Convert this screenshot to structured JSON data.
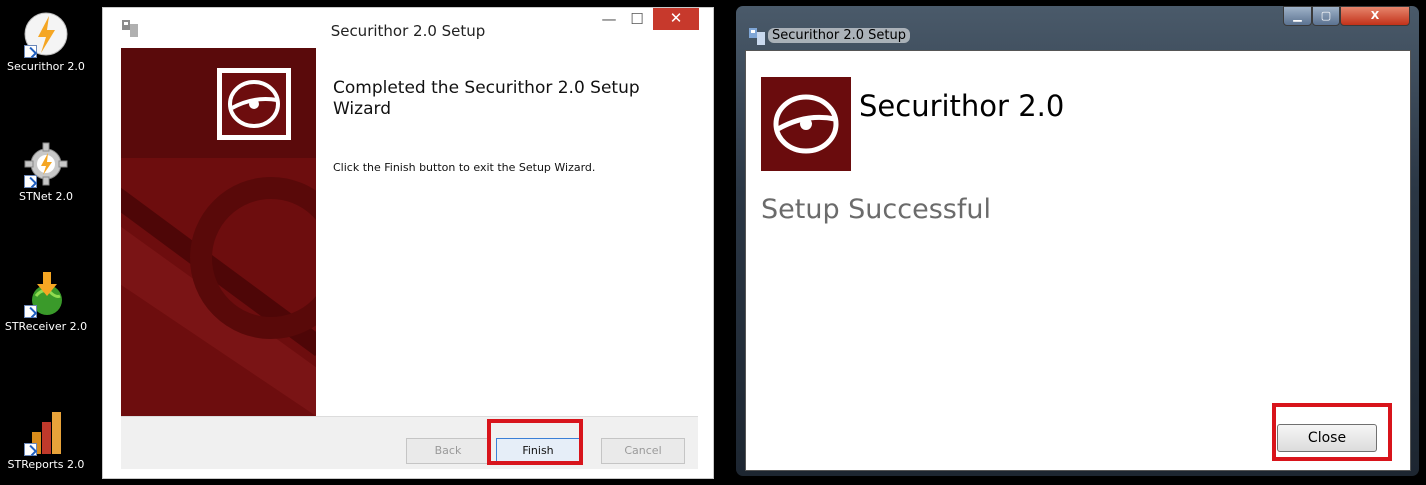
{
  "desktop": {
    "icons": [
      {
        "label": "Securithor 2.0"
      },
      {
        "label": "STNet 2.0"
      },
      {
        "label": "STReceiver 2.0"
      },
      {
        "label": "STReports 2.0"
      }
    ]
  },
  "wizard": {
    "title": "Securithor 2.0 Setup",
    "heading": "Completed the Securithor 2.0 Setup Wizard",
    "message": "Click the Finish button to exit the Setup Wizard.",
    "buttons": {
      "back": "Back",
      "finish": "Finish",
      "cancel": "Cancel"
    },
    "controls": {
      "minimize": "—",
      "maximize": "☐",
      "close": "✕"
    }
  },
  "dialog": {
    "title": "Securithor 2.0 Setup",
    "product": "Securithor 2.0",
    "status": "Setup Successful",
    "close_button": "Close",
    "controls": {
      "close": "X"
    }
  },
  "colors": {
    "highlight": "#d8141b",
    "sidebar": "#6d0d0e",
    "close_red": "#c7392c"
  }
}
